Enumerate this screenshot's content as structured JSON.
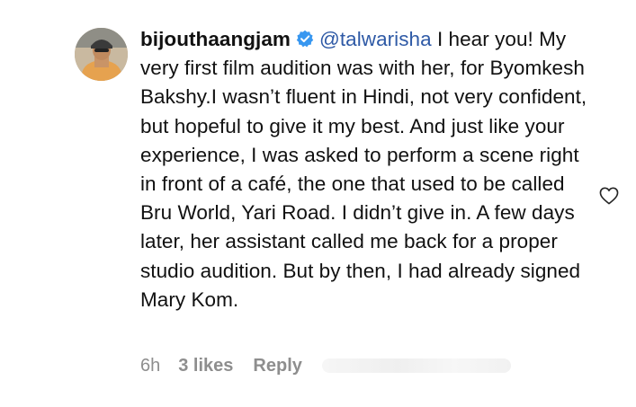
{
  "comment": {
    "username": "bijouthaangjam",
    "verified_icon": "verified-badge-icon",
    "mention": "@talwarisha",
    "text": " I hear you! My very first film audition was with her, for Byomkesh Bakshy.I wasn’t fluent in Hindi, not very confident, but hopeful to give it my best. And just like your experience, I was asked to perform a scene right in front of a café, the one that used to be called Bru World, Yari Road. I didn’t give in. A few days later, her assistant called me back for a proper studio audition. But by then, I had already signed Mary Kom.",
    "time": "6h",
    "likes": "3 likes",
    "reply_label": "Reply",
    "like_icon": "heart-icon"
  },
  "colors": {
    "mention": "#2f5aa6",
    "verified": "#3897f0",
    "meta": "#8e8e8e"
  }
}
